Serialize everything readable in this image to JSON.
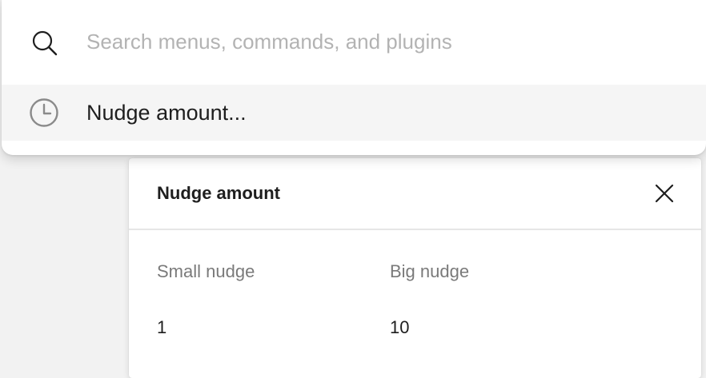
{
  "quick_actions": {
    "search_placeholder": "Search menus, commands, and plugins",
    "search_value": "",
    "icons": {
      "search": "search-icon",
      "recent": "clock-icon"
    },
    "results": [
      {
        "label": "Nudge amount..."
      }
    ]
  },
  "nudge_panel": {
    "title": "Nudge amount",
    "close_icon": "close-icon",
    "small_nudge": {
      "label": "Small nudge",
      "value": "1"
    },
    "big_nudge": {
      "label": "Big nudge",
      "value": "10"
    }
  },
  "colors": {
    "placeholder": "#b3b3b3",
    "text": "#1e1e1e",
    "secondary_text": "#7a7a7a",
    "highlight_row": "#f5f5f5",
    "background": "#f2f2f2"
  }
}
